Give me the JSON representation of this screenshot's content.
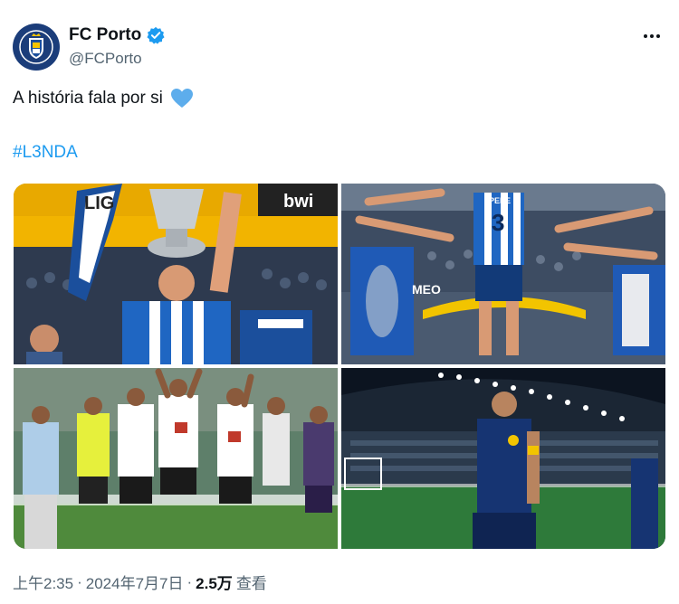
{
  "author": {
    "display_name": "FC Porto",
    "handle": "@FCPorto",
    "verified": true,
    "avatar_icon": "fc-porto-crest-icon"
  },
  "tweet": {
    "text": "A história fala por si",
    "emoji_icon": "blue-heart-icon",
    "hashtag": "#L3NDA"
  },
  "media": {
    "count": 4,
    "photo1_banner_left": "LIG",
    "photo1_banner_right": "bwi",
    "photo2_shirt_name": "PEPE",
    "photo2_shirt_number": "3",
    "photo2_banner": "MEO"
  },
  "footer": {
    "time": "上午2:35",
    "date": "2024年7月7日",
    "sep": "·",
    "views_count": "2.5万",
    "views_label": "查看"
  },
  "colors": {
    "porto_blue": "#1b4f9c",
    "link_blue": "#1d9bf0",
    "verified_blue": "#1d9bf0",
    "muted": "#536471"
  }
}
